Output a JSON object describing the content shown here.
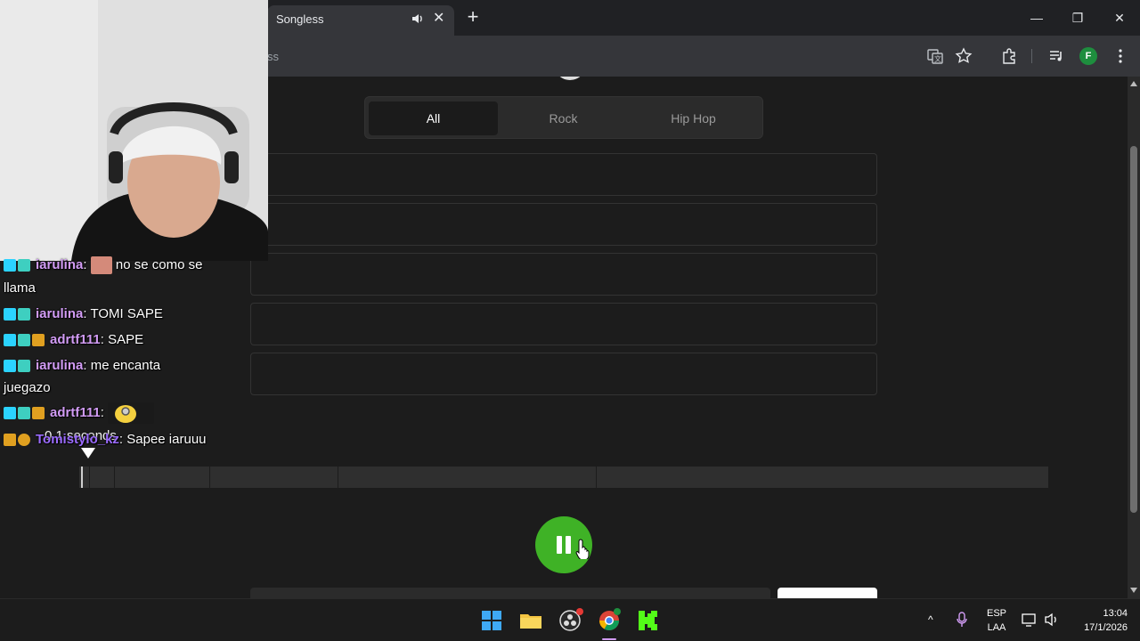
{
  "browser": {
    "tab_title": "Songless",
    "omnibox_text": "ss",
    "profile_initial": "F",
    "window_controls": [
      "minimize",
      "restore",
      "close"
    ],
    "toolbar_icons": [
      "translate-icon",
      "bookmark-star-icon",
      "extensions-icon",
      "media-control-icon",
      "menu-kebab-icon"
    ]
  },
  "page": {
    "genre_tabs": [
      {
        "label": "All",
        "active": true
      },
      {
        "label": "Rock",
        "active": false
      },
      {
        "label": "Hip Hop",
        "active": false
      }
    ],
    "guess_slots_count": 5,
    "player": {
      "time_label": "0.1 seconds",
      "state": "playing",
      "progress_fraction": 0.002,
      "segment_boundaries_fraction": [
        0.01,
        0.036,
        0.134,
        0.267,
        0.533
      ]
    }
  },
  "chat": {
    "messages": [
      {
        "user": "iarulina",
        "user_color": "#d29cf5",
        "emote": true,
        "text": "no se como se",
        "continuation": "llama"
      },
      {
        "user": "iarulina",
        "user_color": "#d29cf5",
        "text": "TOMI SAPE"
      },
      {
        "user": "adrtf111",
        "user_color": "#d29cf5",
        "text": "SAPE"
      },
      {
        "user": "iarulina",
        "user_color": "#d29cf5",
        "text": "me encanta",
        "continuation": "juegazo"
      },
      {
        "user": "adrtf111",
        "user_color": "#d29cf5",
        "emote": true,
        "text": ""
      },
      {
        "user": "Tomistylo_kz",
        "user_color": "#9b6bff",
        "text": "Sapee iaruuu"
      }
    ]
  },
  "taskbar": {
    "apps": [
      "windows-start-icon",
      "file-explorer-icon",
      "obs-icon",
      "chrome-icon",
      "kick-icon"
    ],
    "language_top": "ESP",
    "language_bottom": "LAA",
    "time": "13:04",
    "date": "17/1/2026"
  },
  "colors": {
    "accent_green": "#3fb226",
    "page_bg": "#1c1c1c",
    "chat_username": "#d29cf5"
  }
}
